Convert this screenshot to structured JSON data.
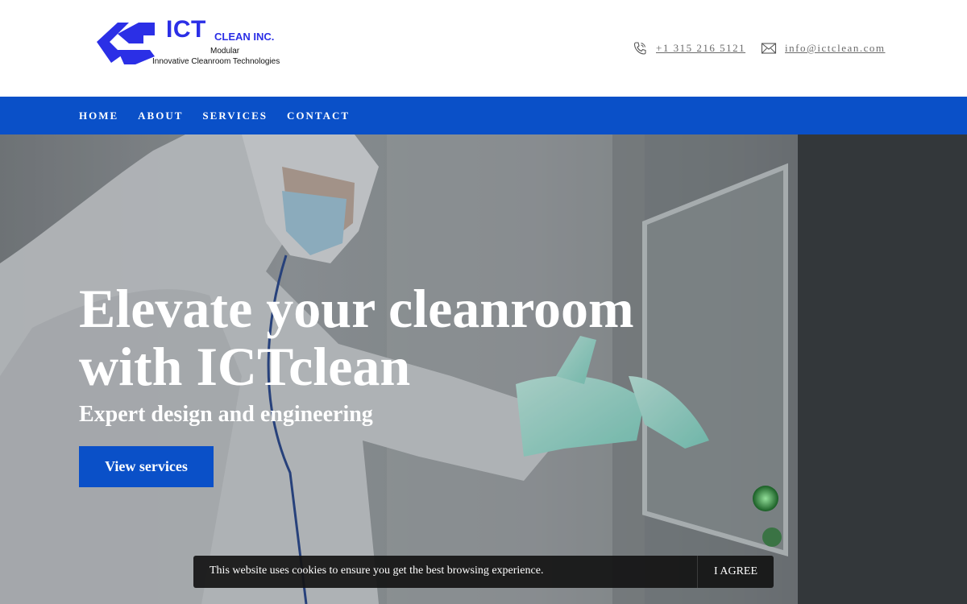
{
  "header": {
    "logo": {
      "brand": "ICT",
      "suffix": "CLEAN INC.",
      "line1": "Modular",
      "line2": "Innovative Cleanroom Technologies"
    },
    "phone": {
      "icon": "phone-icon",
      "text": "+1 315 216 5121"
    },
    "email": {
      "icon": "envelope-icon",
      "text": "info@ictclean.com"
    }
  },
  "nav": {
    "items": [
      {
        "label": "HOME"
      },
      {
        "label": "ABOUT"
      },
      {
        "label": "SERVICES"
      },
      {
        "label": "CONTACT"
      }
    ]
  },
  "hero": {
    "title_line1": "Elevate your cleanroom",
    "title_line2": "with ICTclean",
    "subtitle": "Expert design and engineering",
    "button_label": "View services"
  },
  "cookie": {
    "message": "This website uses cookies to ensure you get the best browsing experience.",
    "agree_label": "I AGREE"
  },
  "colors": {
    "brand_blue": "#0a50c8",
    "logo_blue": "#2b2fe6"
  }
}
